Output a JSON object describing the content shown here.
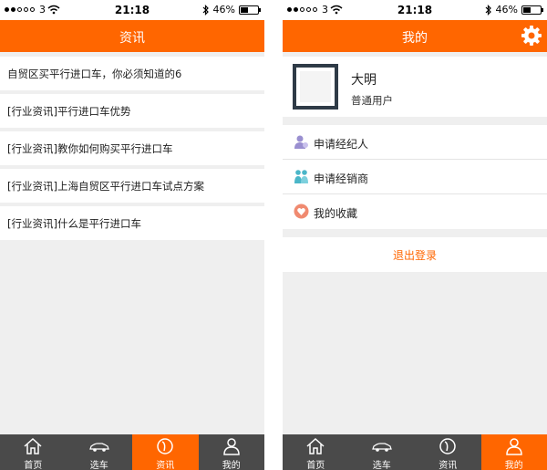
{
  "status_bar": {
    "carrier": "3",
    "time": "21:18",
    "battery": "46%",
    "battery_level": 0.46
  },
  "left": {
    "title": "资讯",
    "news": [
      "自贸区买平行进口车，你必须知道的6",
      "[行业资讯]平行进口车优势",
      "[行业资讯]教你如何购买平行进口车",
      "[行业资讯]上海自贸区平行进口车试点方案",
      "[行业资讯]什么是平行进口车"
    ]
  },
  "right": {
    "title": "我的",
    "profile": {
      "name": "大明",
      "role": "普通用户"
    },
    "menu": [
      {
        "label": "申请经纪人",
        "icon": "agent-icon",
        "color": "#9a8fd0"
      },
      {
        "label": "申请经销商",
        "icon": "dealer-icon",
        "color": "#4ab6c8"
      },
      {
        "label": "我的收藏",
        "icon": "favorites-icon",
        "color": "#f08a70"
      }
    ],
    "logout": "退出登录"
  },
  "tabs": [
    {
      "label": "首页",
      "icon": "home-icon"
    },
    {
      "label": "选车",
      "icon": "car-icon"
    },
    {
      "label": "资讯",
      "icon": "news-icon"
    },
    {
      "label": "我的",
      "icon": "person-icon"
    }
  ],
  "colors": {
    "accent": "#ff6600",
    "tab_bar": "#4a4a4a",
    "background": "#efefef"
  }
}
